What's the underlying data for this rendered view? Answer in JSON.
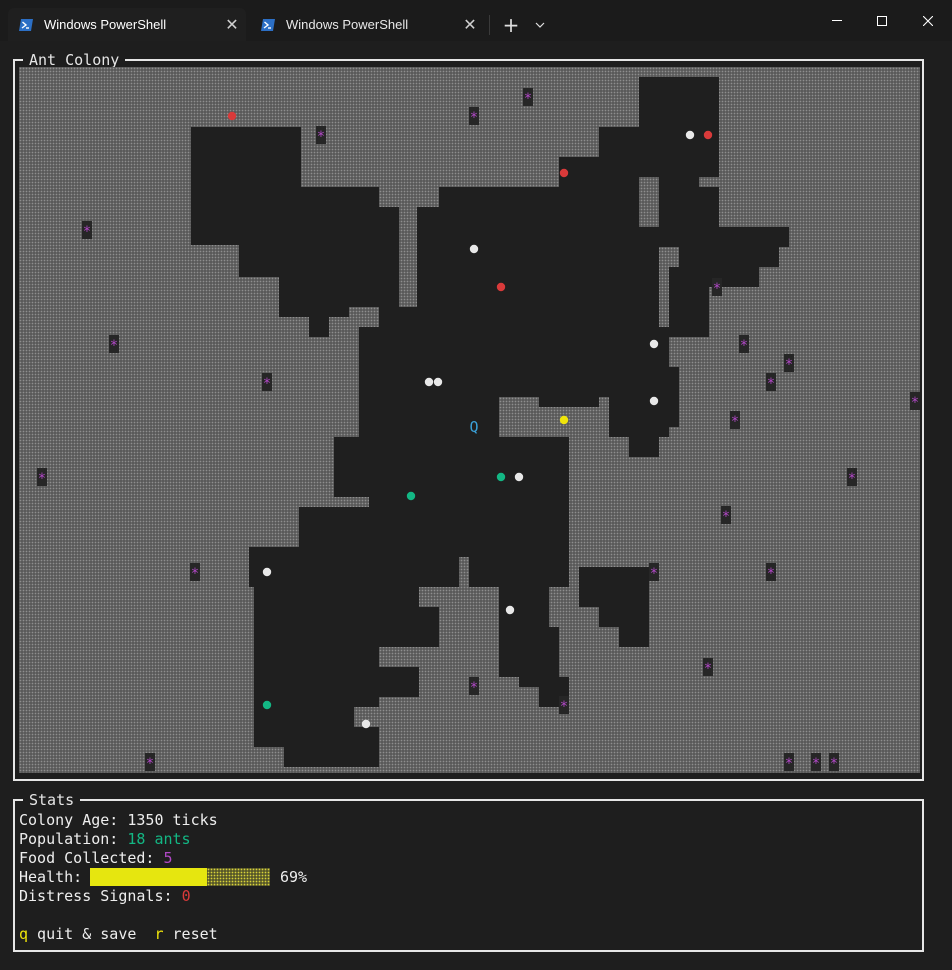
{
  "tabs": [
    {
      "label": "Windows PowerShell",
      "active": true
    },
    {
      "label": "Windows PowerShell",
      "active": false
    }
  ],
  "icons": {
    "tab": "powershell-icon",
    "close": "close-icon",
    "new_tab": "plus-icon",
    "dropdown": "chevron-down-icon",
    "minimize": "minimize-icon",
    "maximize": "maximize-icon",
    "window_close": "window-close-icon"
  },
  "colony": {
    "title": "Ant Colony",
    "queen_label": "Q",
    "food_glyph": "*"
  },
  "stats": {
    "title": "Stats",
    "age_label": "Colony Age: ",
    "age_value": "1350 ticks",
    "population_label": "Population: ",
    "population_value": "18 ants",
    "food_label": "Food Collected: ",
    "food_value": "5",
    "health_label": "Health: ",
    "health_percent": 69,
    "health_text": "69%",
    "distress_label": "Distress Signals: ",
    "distress_value": "0",
    "quit_key": "q",
    "quit_label": " quit & save",
    "reset_key": "r",
    "reset_label": " reset"
  },
  "colors": {
    "background": "#1e1e1e",
    "soil": "#5a5a5a",
    "tunnel": "#1f1f1f",
    "food": "#b148c6",
    "ant_white": "#e8e8e8",
    "ant_red": "#d93a3a",
    "ant_green": "#13b784",
    "ant_yellow": "#f0e50a",
    "queen": "#3aa0d8",
    "health_bar": "#e6e60f"
  }
}
